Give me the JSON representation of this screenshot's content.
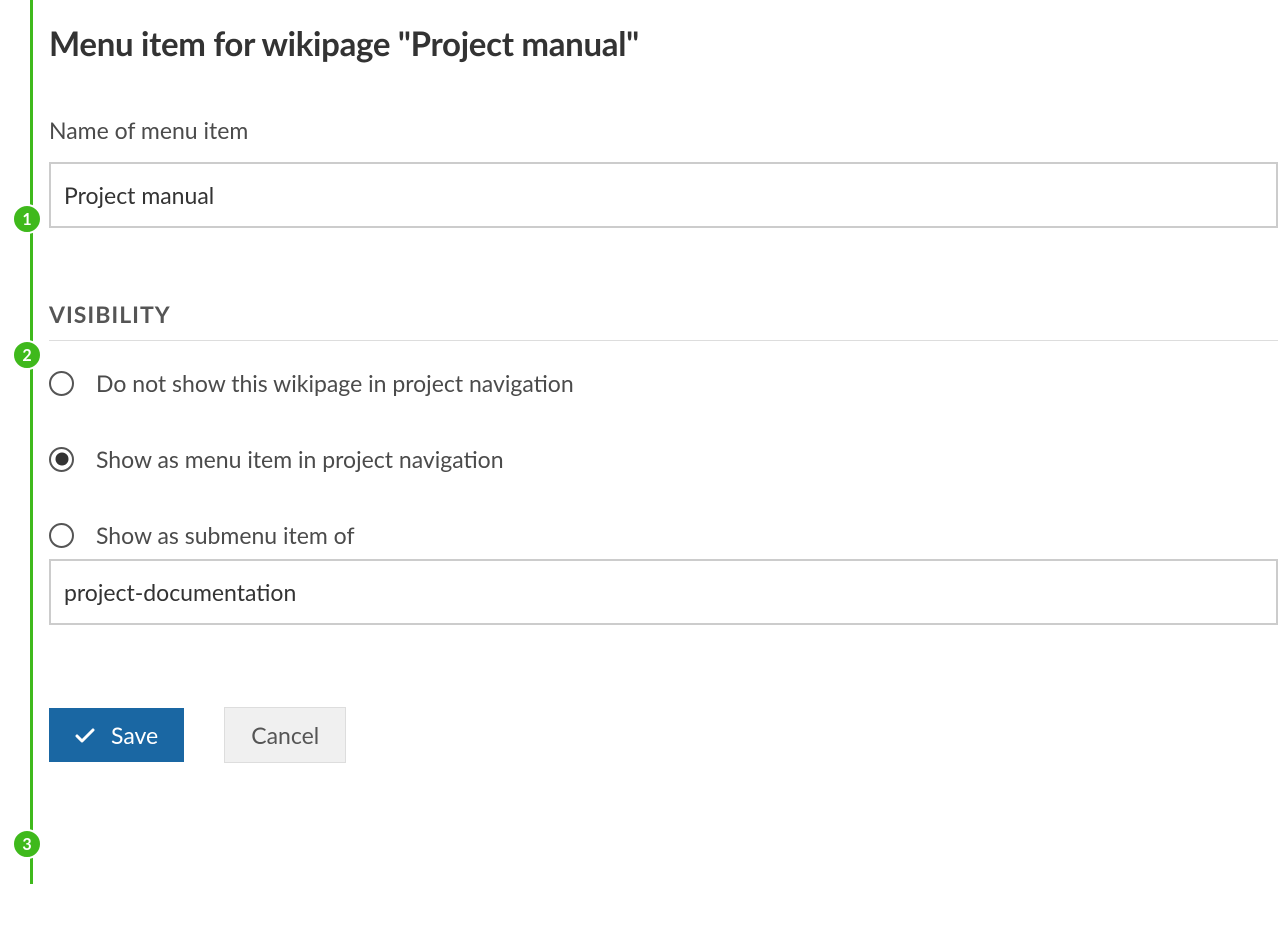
{
  "page": {
    "title": "Menu item for wikipage \"Project manual\""
  },
  "form": {
    "name_label": "Name of menu item",
    "name_value": "Project manual"
  },
  "visibility": {
    "heading": "VISIBILITY",
    "options": [
      {
        "label": "Do not show this wikipage in project navigation",
        "selected": false
      },
      {
        "label": "Show as menu item in project navigation",
        "selected": true
      },
      {
        "label": "Show as submenu item of",
        "selected": false
      }
    ],
    "submenu_value": "project-documentation"
  },
  "buttons": {
    "save": "Save",
    "cancel": "Cancel"
  },
  "markers": {
    "m1": "1",
    "m2": "2",
    "m3": "3"
  }
}
